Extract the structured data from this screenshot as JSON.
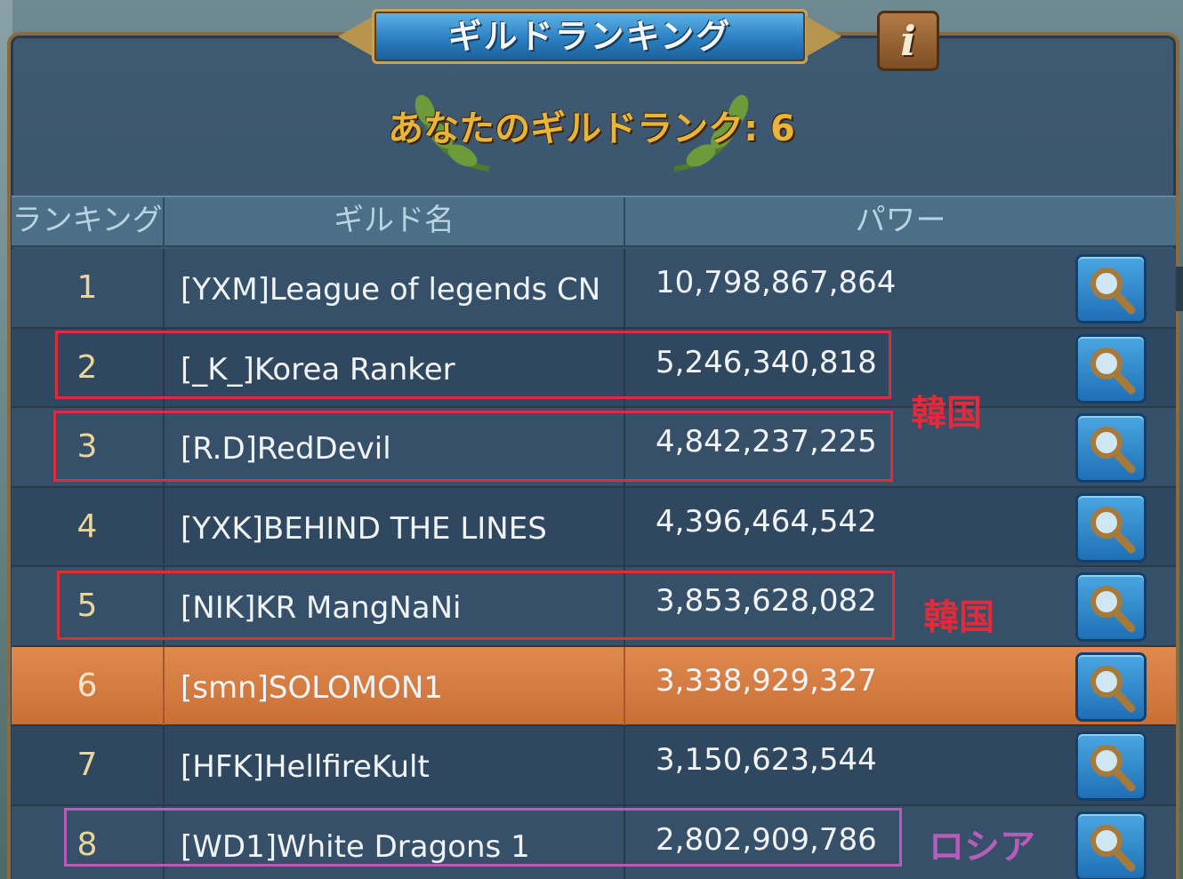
{
  "header": {
    "title": "ギルドランキング",
    "info_icon": "i",
    "your_rank_label": "あなたのギルドランク: 6"
  },
  "columns": {
    "rank": "ランキング",
    "name": "ギルド名",
    "power": "パワー"
  },
  "rows": [
    {
      "rank": "1",
      "name": "[YXM]League of legends CN",
      "power": "10,798,867,864"
    },
    {
      "rank": "2",
      "name": "[_K_]Korea Ranker",
      "power": "5,246,340,818"
    },
    {
      "rank": "3",
      "name": "[R.D]RedDevil",
      "power": "4,842,237,225"
    },
    {
      "rank": "4",
      "name": "[YXK]BEHIND THE LINES",
      "power": "4,396,464,542"
    },
    {
      "rank": "5",
      "name": "[NIK]KR MangNaNi",
      "power": "3,853,628,082"
    },
    {
      "rank": "6",
      "name": "[smn]SOLOMON1",
      "power": "3,338,929,327"
    },
    {
      "rank": "7",
      "name": "[HFK]HellfireKult",
      "power": "3,150,623,544"
    },
    {
      "rank": "8",
      "name": "[WD1]White Dragons 1",
      "power": "2,802,909,786"
    }
  ],
  "annotations": {
    "korea_label_1": "韓国",
    "korea_label_2": "韓国",
    "russia_label": "ロシア",
    "korea_color": "#e12b3a",
    "russia_color": "#b75cb8"
  },
  "highlight_color": "#d97c43",
  "icons": {
    "search": "magnifier-icon",
    "info": "info-icon"
  }
}
